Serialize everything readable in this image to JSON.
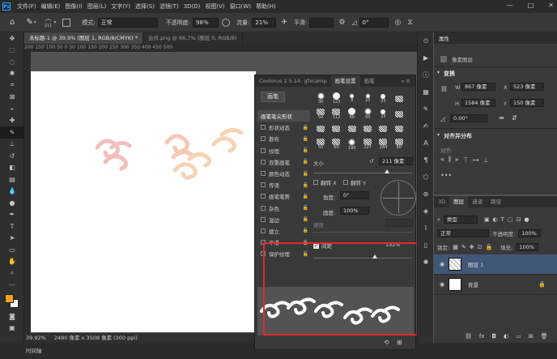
{
  "app_logo": "Ps",
  "menu": [
    "文件(F)",
    "编辑(E)",
    "图像(I)",
    "图层(L)",
    "文字(Y)",
    "选择(S)",
    "滤镜(T)",
    "3D(D)",
    "视图(V)",
    "窗口(W)",
    "帮助(H)"
  ],
  "window_controls": [
    "—",
    "□",
    "✕"
  ],
  "options": {
    "brush_size": "211",
    "mode_label": "模式:",
    "mode_value": "正常",
    "opacity_label": "不透明度:",
    "opacity_value": "98%",
    "flow_label": "流量:",
    "flow_value": "21%",
    "smooth_label": "平滑:",
    "angle_value": "0°"
  },
  "tabs": [
    "未标题-1 @ 39.9% (图层 1, RGB/8/CMYK) *",
    "云纹.png @ 66.7% (图层 0, RGB/8)"
  ],
  "ruler_h": "200  150  100  50   0    50   100  150  200  250  300  350  400  450  500",
  "status_bar": {
    "zoom": "39.92%",
    "doc": "2480 像素 x 3508 像素 (300 ppi)"
  },
  "timeline": "时间轴",
  "brush_panel": {
    "tabs": [
      "Coolorus 2.5.14. gfxcamp",
      "画笔设置",
      "画笔"
    ],
    "brush_button": "画笔",
    "items": [
      {
        "label": "画笔笔尖形状",
        "checkbox": false,
        "lock": false,
        "highlight": true
      },
      {
        "label": "形状动态",
        "checkbox": true,
        "lock": true
      },
      {
        "label": "散布",
        "checkbox": true,
        "lock": true
      },
      {
        "label": "纹理",
        "checkbox": true,
        "lock": true
      },
      {
        "label": "双重画笔",
        "checkbox": true,
        "lock": true
      },
      {
        "label": "颜色动态",
        "checkbox": true,
        "lock": true
      },
      {
        "label": "传递",
        "checkbox": true,
        "lock": true
      },
      {
        "label": "画笔笔势",
        "checkbox": true,
        "lock": true
      },
      {
        "label": "杂色",
        "checkbox": true,
        "lock": true
      },
      {
        "label": "湿边",
        "checkbox": true,
        "lock": true
      },
      {
        "label": "建立",
        "checkbox": true,
        "lock": true
      },
      {
        "label": "平滑",
        "checkbox": true,
        "lock": true
      },
      {
        "label": "保护纹理",
        "checkbox": true,
        "lock": true
      }
    ],
    "tips": [
      "30",
      "123",
      "8",
      "10",
      "25",
      "",
      "50",
      "112",
      "60",
      "50",
      "25",
      "",
      "",
      "",
      "",
      "",
      "",
      "",
      "50",
      "60",
      "100",
      "127",
      "284",
      "80",
      "",
      "",
      "",
      "",
      "",
      ""
    ],
    "size_label": "大小",
    "size_value": "211 像素",
    "flip_x": "翻转 X",
    "flip_y": "翻转 Y",
    "angle_label": "角度:",
    "angle_value": "0°",
    "roundness_label": "圆度:",
    "roundness_value": "100%",
    "hardness_label": "硬度",
    "spacing_label": "间距",
    "spacing_value": "152%"
  },
  "properties": {
    "tab": "属性",
    "layer_type": "像素图层",
    "section_transform": "变换",
    "w_label": "W",
    "w_value": "867 像素",
    "h_label": "H",
    "h_value": "1584 像素",
    "x_label": "X",
    "x_value": "523 像素",
    "y_label": "Y",
    "y_value": "150 像素",
    "angle_value": "0.00°",
    "section_align": "对齐并分布",
    "align_label": "对齐:"
  },
  "layers_panel": {
    "tabs": [
      "3D",
      "图层",
      "通道",
      "路径"
    ],
    "filter_label": "类型",
    "blend_mode": "正常",
    "opacity_label": "不透明度:",
    "opacity_value": "100%",
    "lock_label": "锁定:",
    "fill_label": "填充:",
    "fill_value": "100%",
    "layers": [
      {
        "name": "图层 1",
        "selected": true
      },
      {
        "name": "背景",
        "selected": false
      }
    ]
  },
  "colors": {
    "accent": "#31a8ff",
    "highlight_box": "#e12a2a",
    "foreground": "#f5a021",
    "background_swatch": "#ffffff"
  }
}
